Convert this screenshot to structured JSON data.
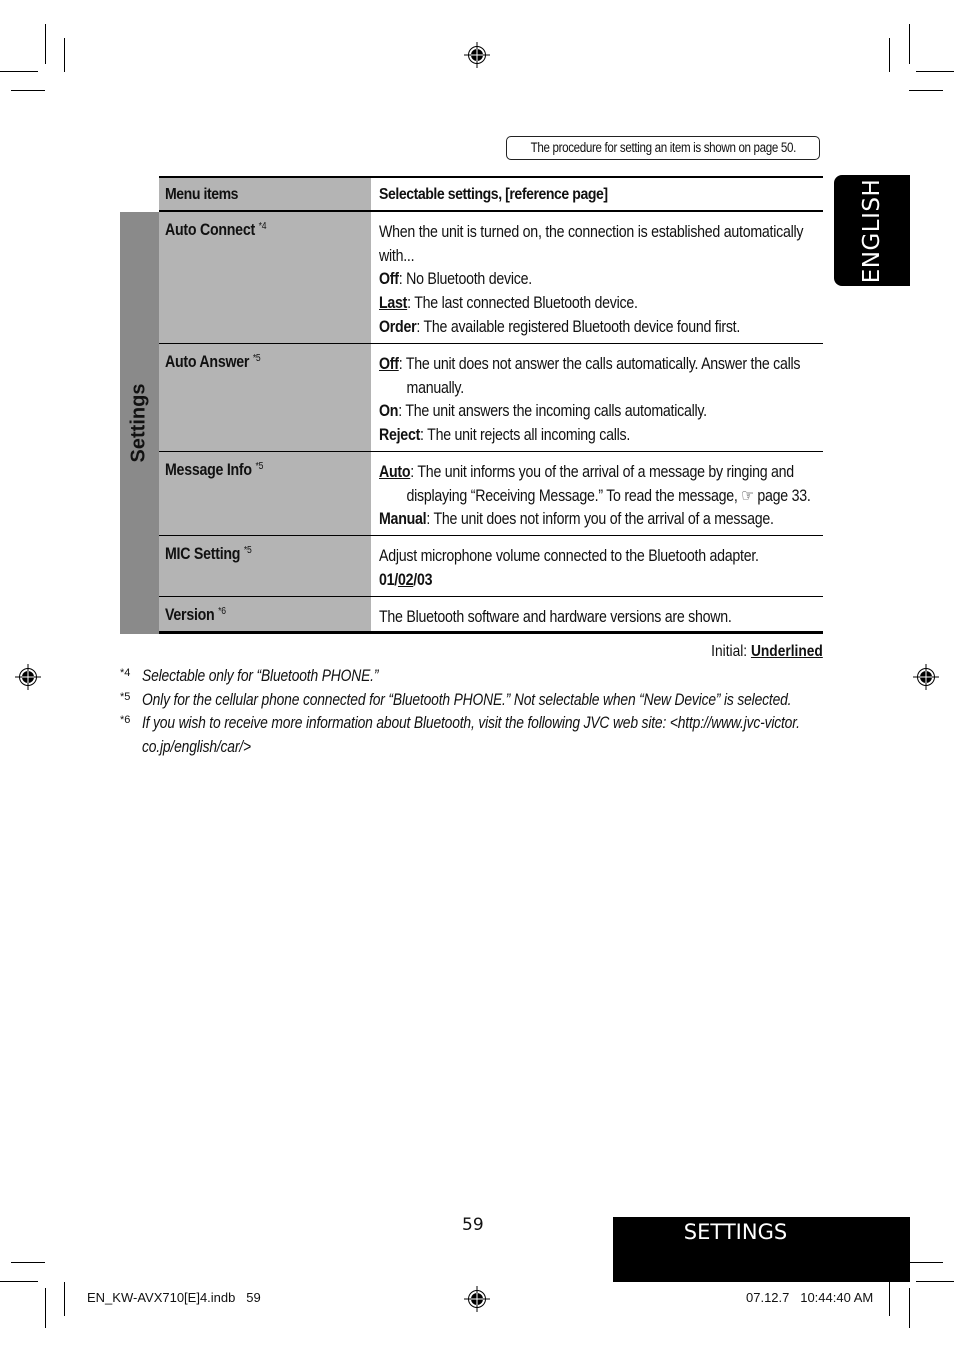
{
  "procedure_note": "The procedure for setting an item is shown on page 50.",
  "language_tab": "ENGLISH",
  "table": {
    "header": {
      "menu_items": "Menu items",
      "settings": "Selectable settings, [reference page]"
    },
    "group_label": "Settings",
    "rows": [
      {
        "item": "Auto Connect",
        "footnote": "*4",
        "lines": [
          {
            "text": "When the unit is turned on, the connection is established automatically"
          },
          {
            "text": "with..."
          },
          {
            "key": "Off",
            "underline": false,
            "text": ": No Bluetooth device."
          },
          {
            "key": "Last",
            "underline": true,
            "text": ": The last connected Bluetooth device."
          },
          {
            "key": "Order",
            "underline": false,
            "text": ": The available registered Bluetooth device found first."
          }
        ]
      },
      {
        "item": "Auto Answer",
        "footnote": "*5",
        "lines": [
          {
            "key": "Off",
            "underline": true,
            "text": ": The unit does not answer the calls automatically. Answer the calls"
          },
          {
            "indent": true,
            "text": "manually."
          },
          {
            "key": "On",
            "underline": false,
            "text": ": The unit answers the incoming calls automatically."
          },
          {
            "key": "Reject",
            "underline": false,
            "text": ": The unit rejects all incoming calls."
          }
        ]
      },
      {
        "item": "Message Info",
        "footnote": "*5",
        "lines": [
          {
            "key": "Auto",
            "underline": true,
            "text": ": The unit informs you of the arrival of a message by ringing and"
          },
          {
            "indent": true,
            "text": "displaying “Receiving Message.” To read the message, ☞ page 33."
          },
          {
            "key": "Manual",
            "underline": false,
            "text": ": The unit does not inform you of the arrival of a message."
          }
        ]
      },
      {
        "item": "MIC Setting",
        "footnote": "*5",
        "lines": [
          {
            "text": "Adjust microphone volume connected to the Bluetooth adapter."
          },
          {
            "options": [
              "01",
              "02",
              "03"
            ],
            "default": "02"
          }
        ]
      },
      {
        "item": "Version",
        "footnote": "*6",
        "lines": [
          {
            "text": "The Bluetooth software and hardware versions are shown."
          }
        ]
      }
    ]
  },
  "initial_note": {
    "label": "Initial:",
    "value": "Underlined"
  },
  "footnotes": [
    {
      "mark": "*4",
      "text": "Selectable only for “Bluetooth PHONE.”"
    },
    {
      "mark": "*5",
      "text": "Only for the cellular phone connected for “Bluetooth PHONE.” Not selectable when “New Device” is selected."
    },
    {
      "mark": "*6",
      "text": "If you wish to receive more information about Bluetooth, visit the following JVC web site: <http://www.jvc-victor.",
      "text2": "co.jp/english/car/>"
    }
  ],
  "page_number": "59",
  "section_title": "SETTINGS",
  "slug": {
    "file": "EN_KW-AVX710[E]4.indb   59",
    "datetime": "07.12.7   10:44:40 AM"
  }
}
